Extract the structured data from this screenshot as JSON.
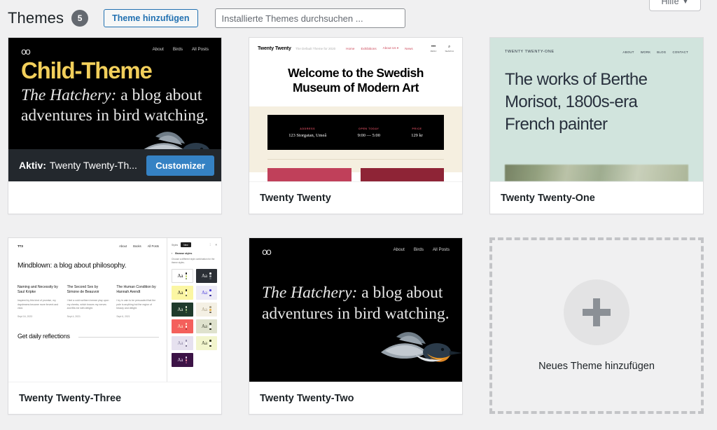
{
  "header": {
    "title": "Themes",
    "count": "5",
    "add_theme_label": "Theme hinzufügen",
    "search_placeholder": "Installierte Themes durchsuchen ...",
    "search_value": "",
    "help_label": "Hilfe",
    "help_caret": "▼"
  },
  "themes": [
    {
      "name": "Child-Theme",
      "active": true,
      "active_label": "Aktiv:",
      "active_name": "Twenty Twenty-Th...",
      "customizer_label": "Customizer",
      "preview": {
        "kind": "dark-bird",
        "logo": "oo",
        "nav": [
          "About",
          "Birds",
          "All Posts"
        ],
        "gold_heading": "Child-Theme",
        "headline_italic": "The Hatchery:",
        "headline_rest": " a blog about adventures in bird watching."
      }
    },
    {
      "name": "Twenty Twenty",
      "active": false,
      "preview": {
        "kind": "tt20",
        "logo": "Twenty Twenty",
        "tagline": "The Default Theme for 2020",
        "nav": [
          "Home",
          "Exhibitions",
          "About Us ▾",
          "News"
        ],
        "icons": [
          {
            "glyph": "•••",
            "label": "MENU"
          },
          {
            "glyph": "⌕",
            "label": "SEARCH"
          }
        ],
        "hero": "Welcome to the Swedish Museum of Modern Art",
        "info": [
          {
            "label": "ADDRESS",
            "value": "123 Storgatan, Umeå"
          },
          {
            "label": "OPEN TODAY",
            "value": "9:00 — 5:00"
          },
          {
            "label": "PRICE",
            "value": "129 kr"
          }
        ],
        "blocks": [
          "#c0405a",
          "#8e2436"
        ]
      }
    },
    {
      "name": "Twenty Twenty-One",
      "active": false,
      "preview": {
        "kind": "tt21",
        "logo": "TWENTY TWENTY-ONE",
        "nav": [
          "ABOUT",
          "WORK",
          "BLOG",
          "CONTACT"
        ],
        "hero": "The works of Berthe Morisot, 1800s-era French painter",
        "background": "#d1e4dd"
      }
    },
    {
      "name": "Twenty Twenty-Three",
      "active": false,
      "preview": {
        "kind": "tt23",
        "logo": "TT3",
        "nav": [
          "About",
          "Books",
          "All Posts"
        ],
        "hero": "Mindblown: a blog about philosophy.",
        "posts": [
          {
            "title": "Naming and Necessity by Saul Kripke",
            "excerpt": "Inspired by this kind of promise, my daydreams became more fervent and vivid.",
            "date": "Sept 16, 2023"
          },
          {
            "title": "The Second Sex by Simone de Beauvoir",
            "excerpt": "I feel a cold northern breeze play upon my cheeks, which braces my nerves and fills me with delight.",
            "date": "Sept 4, 2021"
          },
          {
            "title": "The Human Condition by Hannah Arendt",
            "excerpt": "I try in vain to be persuaded that the pole is anything but the region of beauty and delight.",
            "date": "Sept 6, 2021"
          }
        ],
        "footer_text": "Get daily reflections",
        "sidebar": {
          "label": "Styles",
          "pill": "New",
          "browse_label": "Browse styles",
          "description": "Choose a different style combination for the theme styles.",
          "swatches": [
            {
              "bg": "#ffffff",
              "fg": "#1e1e1e",
              "border": "#dcdcdc",
              "dots": [
                "#1e1e1e",
                "#c8d96f",
                "#6e8b3d"
              ]
            },
            {
              "bg": "#2b2f35",
              "fg": "#f0f0f0",
              "border": "#2b2f35",
              "dots": [
                "#f0f0f0",
                "#9aa0a6",
                "#565b60"
              ]
            },
            {
              "bg": "#fbf6a3",
              "fg": "#1e1e1e",
              "border": "#fbf6a3",
              "dots": [
                "#1e1e1e",
                "#ffffff",
                "#3a3a3a"
              ]
            },
            {
              "bg": "#eceaf6",
              "fg": "#4b3ddb",
              "border": "#eceaf6",
              "dots": [
                "#4b3ddb",
                "#ffffff",
                "#2c2394"
              ]
            },
            {
              "bg": "#1f3b2c",
              "fg": "#eef3e2",
              "border": "#1f3b2c",
              "dots": [
                "#eef3e2",
                "#9dc183",
                "#567a45"
              ]
            },
            {
              "bg": "#f4f0e4",
              "fg": "#a99e83",
              "border": "#f4f0e4",
              "dots": [
                "#a99e83",
                "#e8b34a",
                "#6c6352"
              ]
            },
            {
              "bg": "#f4605c",
              "fg": "#fbe9c8",
              "border": "#f4605c",
              "dots": [
                "#fbe9c8",
                "#ffffff",
                "#9e2f2c"
              ]
            },
            {
              "bg": "#dfe2cd",
              "fg": "#3b4030",
              "border": "#dfe2cd",
              "dots": [
                "#3b4030",
                "#ffffff",
                "#23261b"
              ]
            },
            {
              "bg": "#e6e1ef",
              "fg": "#8e87a6",
              "border": "#e6e1ef",
              "dots": [
                "#8e87a6",
                "#ffffff",
                "#564f6b"
              ]
            },
            {
              "bg": "#f2f5cd",
              "fg": "#2f3420",
              "border": "#f2f5cd",
              "dots": [
                "#2f3420",
                "#ffffff",
                "#1a1c10"
              ]
            },
            {
              "bg": "#3c1346",
              "fg": "#e8d9ef",
              "border": "#3c1346",
              "dots": [
                "#e8d9ef",
                "#ef8ea0",
                "#a0497a"
              ]
            }
          ]
        }
      }
    },
    {
      "name": "Twenty Twenty-Two",
      "active": false,
      "preview": {
        "kind": "dark-bird",
        "logo": "oo",
        "nav": [
          "About",
          "Birds",
          "All Posts"
        ],
        "gold_heading": "",
        "headline_italic": "The Hatchery:",
        "headline_rest": " a blog about adventures in bird watching."
      }
    }
  ],
  "add_new": {
    "label": "Neues Theme hinzufügen",
    "icon": "plus-icon"
  }
}
